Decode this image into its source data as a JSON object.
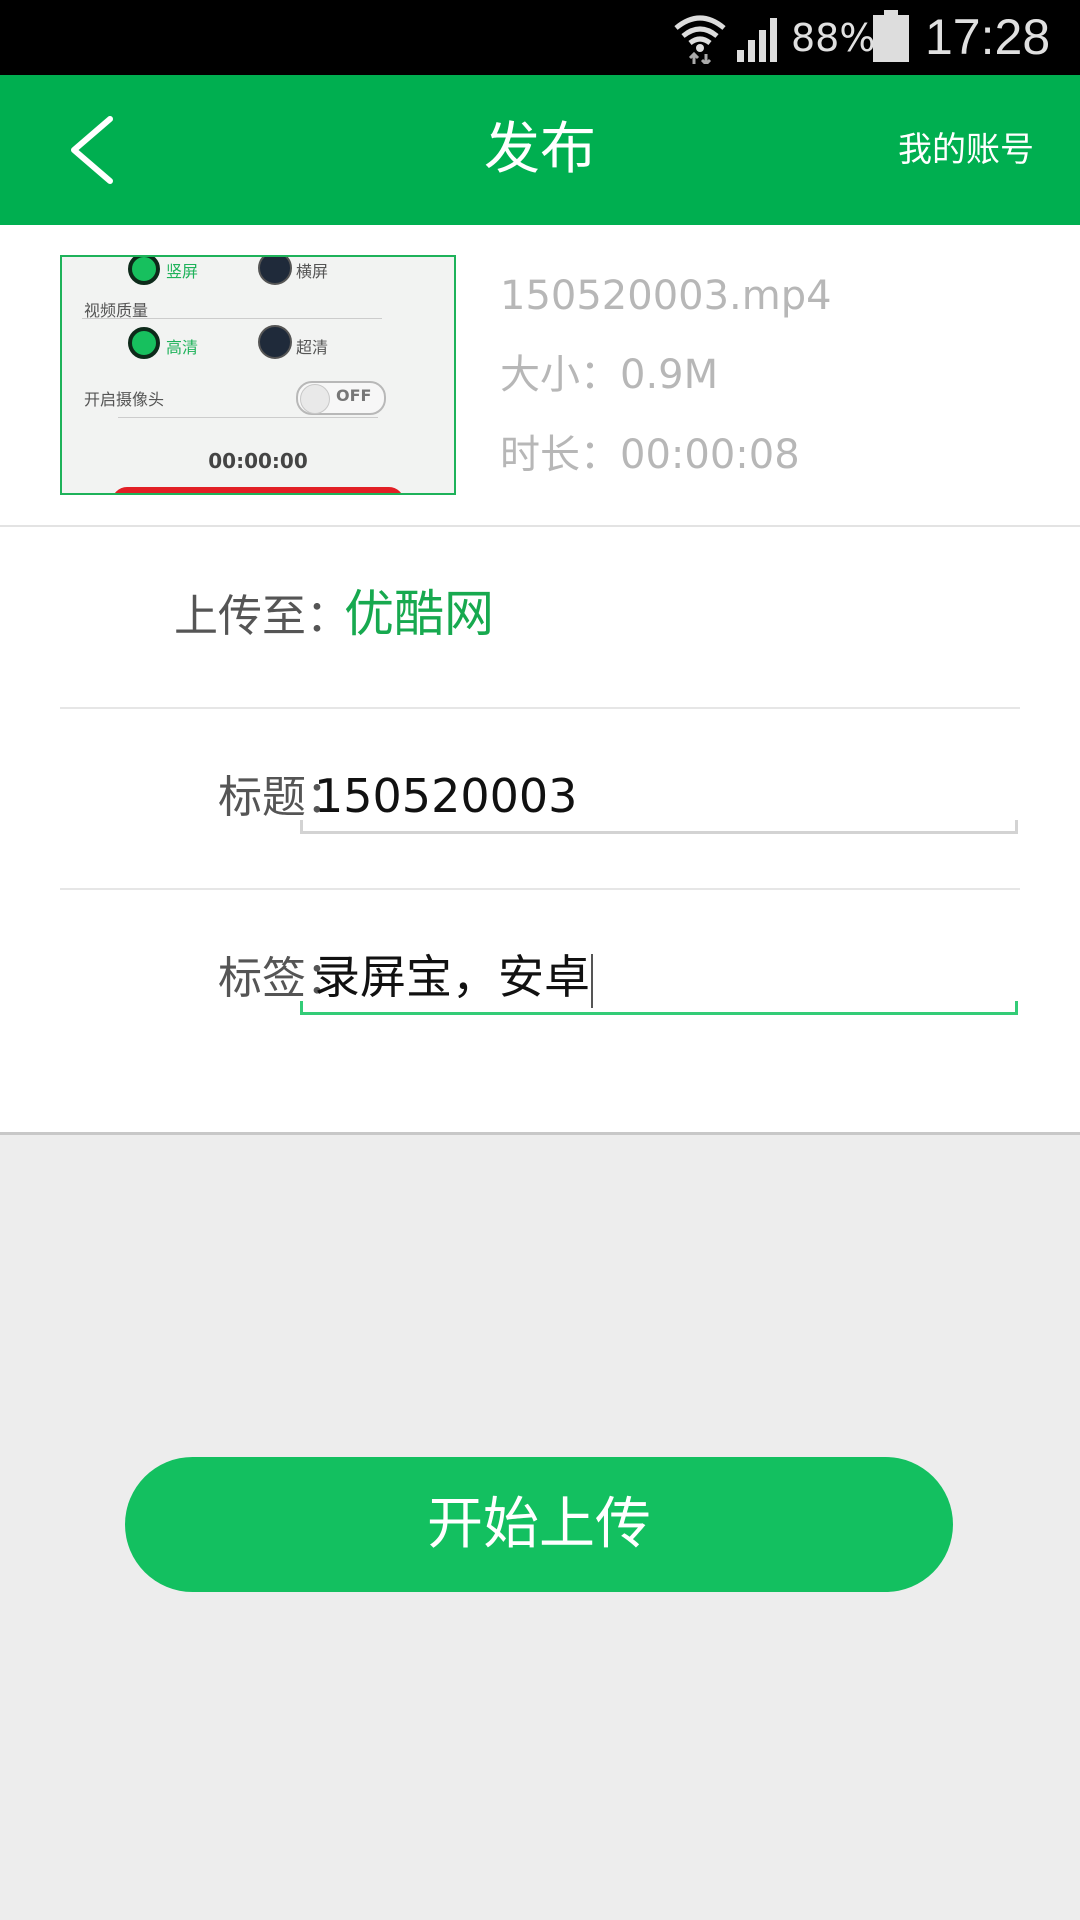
{
  "status_bar": {
    "battery_percent": "88%",
    "time": "17:28",
    "icons": [
      "wifi-icon",
      "signal-icon",
      "battery-icon"
    ]
  },
  "app_bar": {
    "back_icon": "chevron-left-icon",
    "title": "发布",
    "account_label": "我的账号"
  },
  "video": {
    "thumbnail": {
      "portrait_label": "竖屏",
      "landscape_label": "横屏",
      "quality_heading": "视频质量",
      "hd_label": "高清",
      "uhd_label": "超清",
      "camera_label": "开启摄像头",
      "toggle_state": "OFF",
      "timer": "00:00:00"
    },
    "filename": "150520003.mp4",
    "size": "大小：0.9M",
    "duration": "时长：00:00:08"
  },
  "form": {
    "upload_to": {
      "label": "上传至：",
      "value": "优酷网"
    },
    "title": {
      "label": "标题：",
      "value": "150520003"
    },
    "tags": {
      "label": "标签：",
      "value": "录屏宝，安卓"
    }
  },
  "upload_button": "开始上传",
  "colors": {
    "brand_green": "#00af50",
    "button_green": "#13c060",
    "link_green": "#17a94f",
    "background": "#ededed"
  }
}
